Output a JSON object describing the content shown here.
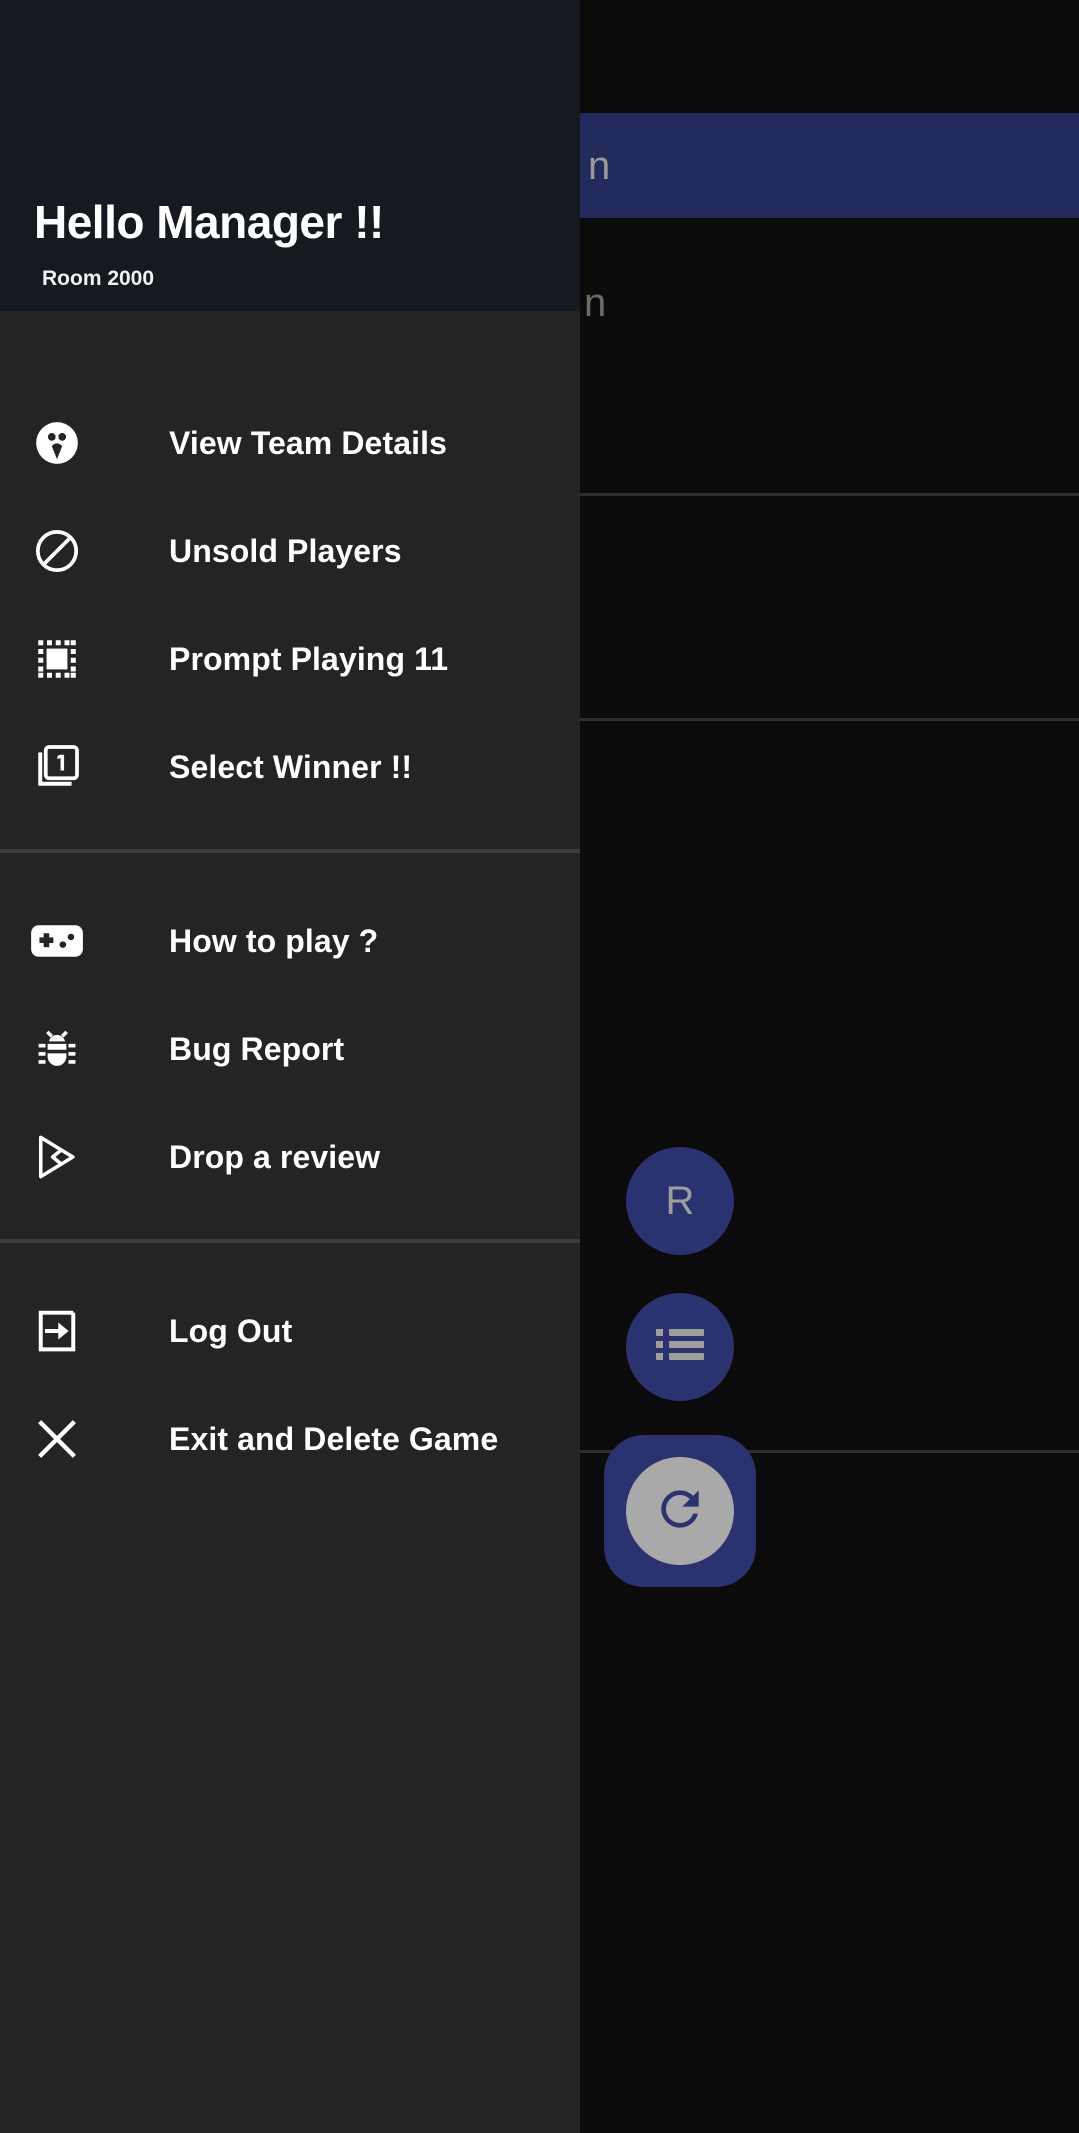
{
  "drawer": {
    "title": "Hello Manager !!",
    "subtitle": "Room 2000",
    "groups": [
      {
        "id": "main",
        "items": [
          {
            "label": "View Team Details",
            "icon": "group-people-icon"
          },
          {
            "label": "Unsold Players",
            "icon": "block-circle-slash-icon"
          },
          {
            "label": "Prompt Playing 11",
            "icon": "select-all-dotted-square-icon"
          },
          {
            "label": "Select Winner !!",
            "icon": "filter-one-stacked-icon"
          }
        ]
      },
      {
        "id": "help",
        "items": [
          {
            "label": "How to play  ?",
            "icon": "gamepad-icon"
          },
          {
            "label": "Bug Report",
            "icon": "bug-icon"
          },
          {
            "label": "Drop a review",
            "icon": "google-play-icon"
          }
        ]
      },
      {
        "id": "account",
        "items": [
          {
            "label": "Log Out",
            "icon": "logout-arrow-box-icon"
          },
          {
            "label": "Exit and Delete Game",
            "icon": "close-x-icon"
          }
        ]
      }
    ]
  },
  "background": {
    "banner_text": "n",
    "ghost_text": "n",
    "fab_profile_letter": "R",
    "fab_list_icon": "list-icon",
    "fab_refresh_icon": "refresh-icon"
  },
  "colors": {
    "drawer_background": "#242424",
    "header_background": "#151a21",
    "divider": "#3d3d3d",
    "accent_blue": "#2a3270",
    "banner_blue": "#232a5c",
    "text_primary": "#ffffff",
    "refresh_circle": "#a9a9a9"
  }
}
